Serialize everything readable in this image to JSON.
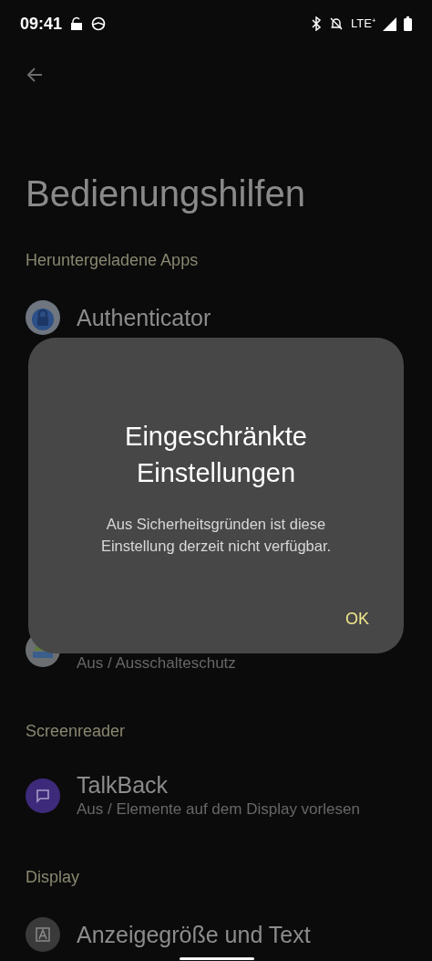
{
  "status_bar": {
    "time": "09:41",
    "network": "LTE⁺"
  },
  "page": {
    "title": "Bedienungshilfen"
  },
  "sections": [
    {
      "header": "Heruntergeladene Apps",
      "items": [
        {
          "kind": "authenticator",
          "title": "Authenticator"
        },
        {
          "kind": "sleep",
          "subtitle": "Aus / Ausschalteschutz"
        }
      ]
    },
    {
      "header": "Screenreader",
      "items": [
        {
          "kind": "talkback",
          "title": "TalkBack",
          "subtitle": "Aus / Elemente auf dem Display vorlesen"
        }
      ]
    },
    {
      "header": "Display",
      "items": [
        {
          "kind": "display",
          "title": "Anzeigegröße und Text"
        }
      ]
    }
  ],
  "dialog": {
    "title": "Eingeschränkte Einstellungen",
    "message": "Aus Sicherheitsgründen ist diese Einstellung derzeit nicht verfügbar.",
    "button": "OK"
  }
}
